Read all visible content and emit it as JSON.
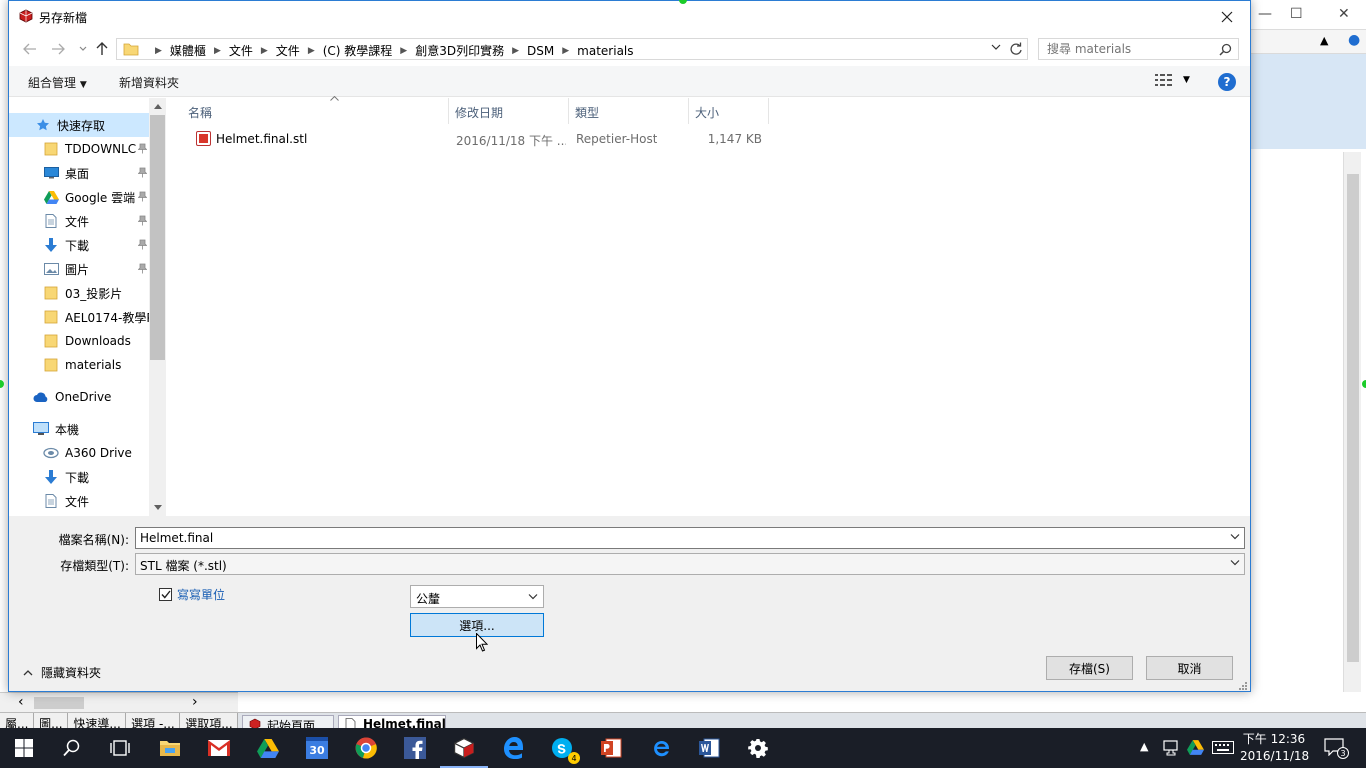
{
  "dialog": {
    "title": "另存新檔",
    "address_crumbs": [
      "媒體櫃",
      "文件",
      "文件",
      "(C) 教學課程",
      "創意3D列印實務",
      "DSM",
      "materials"
    ],
    "search_placeholder": "搜尋 materials",
    "toolbar": {
      "organize": "組合管理",
      "new_folder": "新增資料夾"
    },
    "help_label": "?",
    "nav": {
      "quick_access": "快速存取",
      "items": [
        "TDDOWNLC",
        "桌面",
        "Google 雲端",
        "文件",
        "下載",
        "圖片",
        "03_投影片",
        "AEL0174-教學P",
        "Downloads",
        "materials"
      ],
      "onedrive": "OneDrive",
      "this_pc": "本機",
      "pc_items": [
        "A360 Drive",
        "下載",
        "文件"
      ]
    },
    "columns": [
      "名稱",
      "修改日期",
      "類型",
      "大小"
    ],
    "files": [
      {
        "name": "Helmet.final.stl",
        "date": "2016/11/18 下午 ...",
        "type": "Repetier-Host",
        "size": "1,147 KB"
      }
    ],
    "filename_label": "檔案名稱(N):",
    "filename_value": "Helmet.final",
    "filetype_label": "存檔類型(T):",
    "filetype_value": "STL 檔案 (*.stl)",
    "write_units_label": "寫寫單位",
    "write_units_checked": true,
    "unit_value": "公釐",
    "options_label": "選項...",
    "hide_folders_label": "隱藏資料夾",
    "save_label": "存檔(S)",
    "cancel_label": "取消"
  },
  "background": {
    "panel_tabs": [
      "屬...",
      "圖...",
      "快速導...",
      "選項 -...",
      "選取項..."
    ],
    "doc_tabs": [
      "起始頁面",
      "Helmet.final"
    ],
    "close_glyph": "×"
  },
  "taskbar": {
    "calendar_day": "30",
    "skype_badge": "4",
    "time": "下午 12:36",
    "date": "2016/11/18",
    "notification_count": "3",
    "accent": "#1a1e27"
  },
  "colors": {
    "accent_blue": "#0078d7",
    "selection": "#cce8ff",
    "help_blue": "#1f6dd0"
  }
}
